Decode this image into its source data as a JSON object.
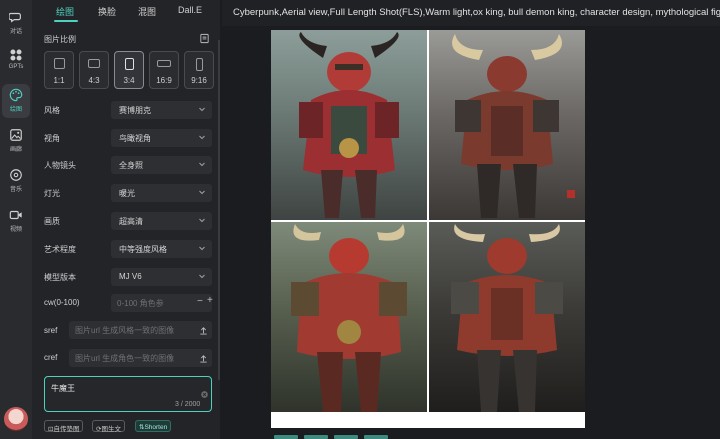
{
  "rail": {
    "items": [
      {
        "label": "对话",
        "icon": "chat-icon"
      },
      {
        "label": "GPTs",
        "icon": "apps-icon"
      },
      {
        "label": "绘图",
        "icon": "palette-icon"
      },
      {
        "label": "画廊",
        "icon": "gallery-icon"
      },
      {
        "label": "音乐",
        "icon": "music-icon"
      },
      {
        "label": "视频",
        "icon": "video-icon"
      }
    ],
    "active": 2
  },
  "tabs": [
    "绘图",
    "换脸",
    "混图",
    "Dall.E"
  ],
  "ratio_section": {
    "title": "图片比例",
    "options": [
      "1:1",
      "4:3",
      "3:4",
      "16:9",
      "9:16"
    ],
    "selected": "3:4"
  },
  "settings": [
    {
      "label": "风格",
      "value": "赛博朋克"
    },
    {
      "label": "视角",
      "value": "鸟瞰视角"
    },
    {
      "label": "人物镜头",
      "value": "全身照"
    },
    {
      "label": "灯光",
      "value": "暖光"
    },
    {
      "label": "画质",
      "value": "超高清"
    },
    {
      "label": "艺术程度",
      "value": "中等强度风格"
    },
    {
      "label": "模型版本",
      "value": "MJ V6"
    }
  ],
  "cw": {
    "label": "cw(0-100)",
    "placeholder": "0-100 角色参"
  },
  "sref": {
    "label": "sref",
    "placeholder": "图片url 生成风格一致的图像"
  },
  "cref": {
    "label": "cref",
    "placeholder": "图片url 生成角色一致的图像"
  },
  "prompt_input": {
    "value": "牛魔王",
    "counter": "3 / 2000"
  },
  "chips": [
    "自传垫图",
    "图生文",
    "Shorten"
  ],
  "main": {
    "prompt_text": "Cyberpunk,Aerial view,Full Length Shot(FLS),Warm light,ox king, bull demon king, character design, mythological fig"
  },
  "colors": {
    "accent": "#4fd1c0",
    "panel": "#232428",
    "background": "#1b1c1f"
  }
}
